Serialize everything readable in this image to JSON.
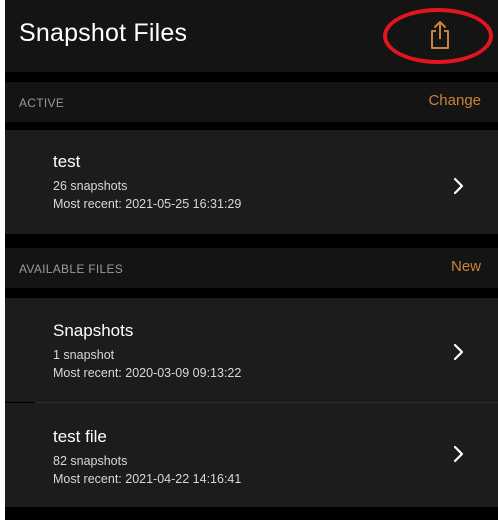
{
  "navbar": {
    "title": "Snapshot Files",
    "share_icon": "share-icon"
  },
  "active_section": {
    "header": "ACTIVE",
    "action": "Change",
    "file": {
      "name": "test",
      "count": "26 snapshots",
      "recent": "Most recent: 2021-05-25 16:31:29"
    }
  },
  "available_section": {
    "header": "AVAILABLE FILES",
    "action": "New",
    "files": [
      {
        "name": "Snapshots",
        "count": "1 snapshot",
        "recent": "Most recent: 2020-03-09 09:13:22"
      },
      {
        "name": "test file",
        "count": "82 snapshots",
        "recent": "Most recent: 2021-04-22 14:16:41"
      }
    ]
  },
  "colors": {
    "accent": "#c8843a",
    "highlight": "#e3141d",
    "background": "#000000",
    "row_background": "#1c1c1e",
    "header_background": "#141414"
  }
}
